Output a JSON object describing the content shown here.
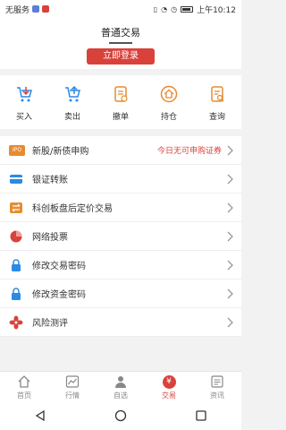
{
  "status_bar": {
    "carrier": "无服务",
    "time": "上午10:12"
  },
  "header": {
    "title": "普通交易",
    "login_label": "立即登录"
  },
  "quick_actions": [
    {
      "label": "买入",
      "icon": "buy-icon"
    },
    {
      "label": "卖出",
      "icon": "sell-icon"
    },
    {
      "label": "撤单",
      "icon": "cancel-order-icon"
    },
    {
      "label": "持仓",
      "icon": "holdings-icon"
    },
    {
      "label": "查询",
      "icon": "query-icon"
    }
  ],
  "menu": [
    {
      "label": "新股/新债申购",
      "note": "今日无可申购证券",
      "icon": "ipo-icon"
    },
    {
      "label": "银证转账",
      "icon": "card-transfer-icon"
    },
    {
      "label": "科创板盘后定价交易",
      "icon": "swap-icon"
    },
    {
      "label": "网络投票",
      "icon": "pie-chart-icon"
    },
    {
      "label": "修改交易密码",
      "icon": "lock-icon"
    },
    {
      "label": "修改资金密码",
      "icon": "lock-icon"
    },
    {
      "label": "风险测评",
      "icon": "flower-icon"
    }
  ],
  "ipo_icon_text": "IPO",
  "tabs": [
    {
      "label": "首页",
      "icon": "home-icon"
    },
    {
      "label": "行情",
      "icon": "market-icon"
    },
    {
      "label": "自选",
      "icon": "user-icon"
    },
    {
      "label": "交易",
      "icon": "trade-icon",
      "active": true
    },
    {
      "label": "资讯",
      "icon": "news-icon"
    }
  ],
  "trade_tab_glyph": "¥",
  "colors": {
    "accent": "#d9423b",
    "icon_blue": "#2a8ae6",
    "icon_orange": "#e88b2e"
  }
}
